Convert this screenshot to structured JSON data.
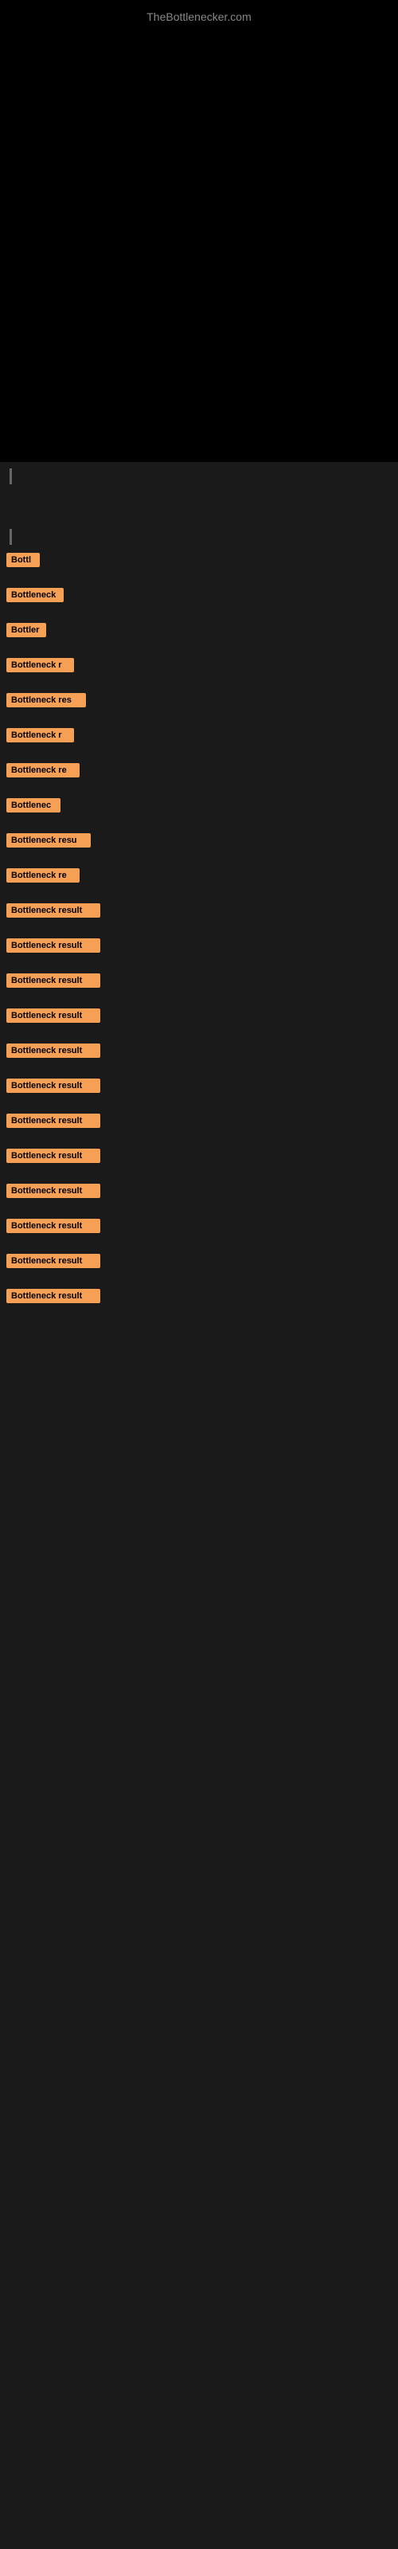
{
  "site": {
    "title": "TheBottlenecker.com"
  },
  "results": [
    {
      "id": 1,
      "label": "Bottl",
      "width": 42
    },
    {
      "id": 2,
      "label": "Bottleneck",
      "width": 72
    },
    {
      "id": 3,
      "label": "Bottler",
      "width": 50
    },
    {
      "id": 4,
      "label": "Bottleneck r",
      "width": 85
    },
    {
      "id": 5,
      "label": "Bottleneck res",
      "width": 100
    },
    {
      "id": 6,
      "label": "Bottleneck r",
      "width": 85
    },
    {
      "id": 7,
      "label": "Bottleneck re",
      "width": 92
    },
    {
      "id": 8,
      "label": "Bottlenec",
      "width": 68
    },
    {
      "id": 9,
      "label": "Bottleneck resu",
      "width": 106
    },
    {
      "id": 10,
      "label": "Bottleneck re",
      "width": 92
    },
    {
      "id": 11,
      "label": "Bottleneck result",
      "width": 118
    },
    {
      "id": 12,
      "label": "Bottleneck result",
      "width": 118
    },
    {
      "id": 13,
      "label": "Bottleneck result",
      "width": 118
    },
    {
      "id": 14,
      "label": "Bottleneck result",
      "width": 118
    },
    {
      "id": 15,
      "label": "Bottleneck result",
      "width": 118
    },
    {
      "id": 16,
      "label": "Bottleneck result",
      "width": 118
    },
    {
      "id": 17,
      "label": "Bottleneck result",
      "width": 118
    },
    {
      "id": 18,
      "label": "Bottleneck result",
      "width": 118
    },
    {
      "id": 19,
      "label": "Bottleneck result",
      "width": 118
    },
    {
      "id": 20,
      "label": "Bottleneck result",
      "width": 118
    },
    {
      "id": 21,
      "label": "Bottleneck result",
      "width": 118
    },
    {
      "id": 22,
      "label": "Bottleneck result",
      "width": 118
    }
  ],
  "colors": {
    "badge_bg": "#f5a055",
    "bg_dark": "#000000",
    "bg_body": "#1a1a1a",
    "site_title": "#888888"
  }
}
